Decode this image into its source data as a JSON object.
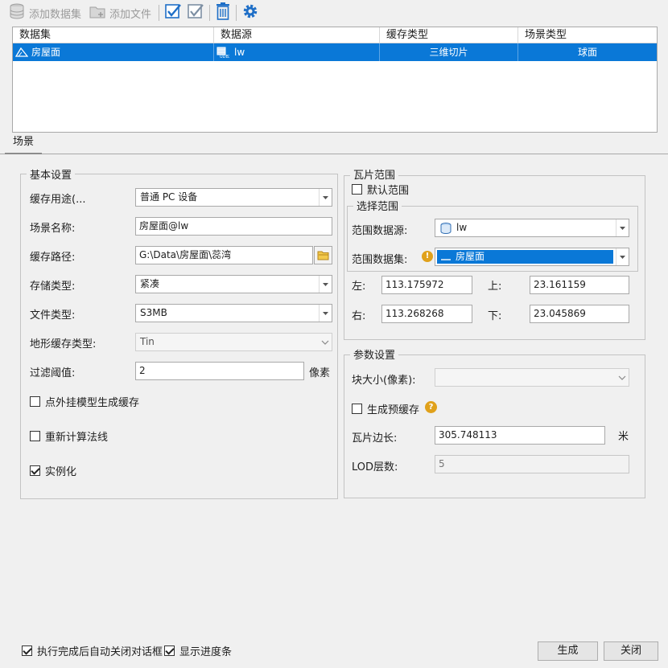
{
  "toolbar": {
    "add_dataset": "添加数据集",
    "add_file": "添加文件"
  },
  "grid": {
    "headers": [
      "数据集",
      "数据源",
      "缓存类型",
      "场景类型"
    ],
    "rows": [
      {
        "dataset": "房屋面",
        "datasource": "lw",
        "cache_type": "三维切片",
        "scene_type": "球面"
      }
    ]
  },
  "tab": "场景",
  "basic": {
    "title": "基本设置",
    "cache_usage_label": "缓存用途(...",
    "cache_usage_value": "普通 PC 设备",
    "scene_name_label": "场景名称:",
    "scene_name_value": "房屋面@lw",
    "cache_path_label": "缓存路径:",
    "cache_path_value": "G:\\Data\\房屋面\\蕊湾",
    "storage_type_label": "存储类型:",
    "storage_type_value": "紧凑",
    "file_type_label": "文件类型:",
    "file_type_value": "S3MB",
    "terrain_cache_label": "地形缓存类型:",
    "terrain_cache_value": "Tin",
    "filter_label": "过滤阈值:",
    "filter_value": "2",
    "filter_unit": "像素",
    "chk_point_model": "点外挂模型生成缓存",
    "chk_recalc_normal": "重新计算法线",
    "chk_instancing": "实例化"
  },
  "tile": {
    "title": "瓦片范围",
    "default_range": "默认范围",
    "select_title": "选择范围",
    "ds_label": "范围数据源:",
    "ds_value": "lw",
    "dataset_label": "范围数据集:",
    "dataset_value": "房屋面",
    "left_label": "左:",
    "left_value": "113.175972",
    "top_label": "上:",
    "top_value": "23.161159",
    "right_label": "右:",
    "right_value": "113.268268",
    "bottom_label": "下:",
    "bottom_value": "23.045869"
  },
  "params": {
    "title": "参数设置",
    "block_size_label": "块大小(像素):",
    "block_size_value": "",
    "gen_precache": "生成预缓存",
    "tile_edge_label": "瓦片边长:",
    "tile_edge_value": "305.748113",
    "tile_edge_unit": "米",
    "lod_label": "LOD层数:",
    "lod_value": "5"
  },
  "footer": {
    "auto_close": "执行完成后自动关闭对话框",
    "show_progress": "显示进度条",
    "generate": "生成",
    "close": "关闭"
  },
  "colors": {
    "accent": "#0a78d7",
    "icon_blue": "#1f6fc7",
    "warn": "#e0a11b"
  }
}
